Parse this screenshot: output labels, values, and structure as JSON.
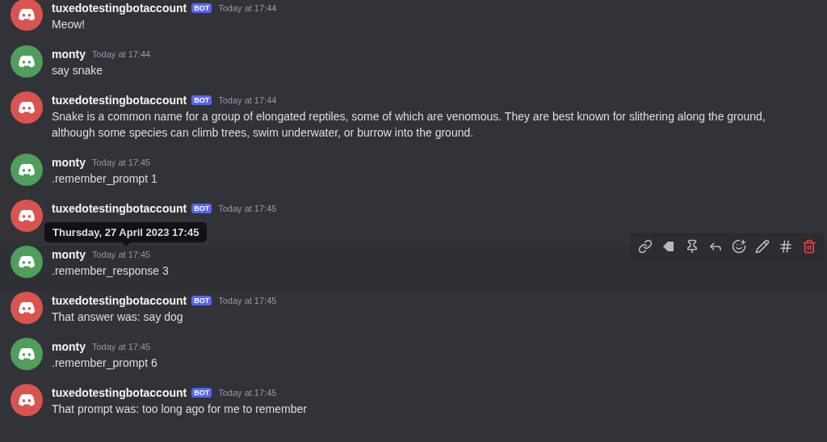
{
  "messages": [
    {
      "author": "tuxedotestingbotaccount",
      "bot": true,
      "badge": "BOT",
      "color": "#d9534f",
      "time": "Today at 17:44",
      "lines": [
        "Meow!"
      ],
      "hovered": false
    },
    {
      "author": "monty",
      "bot": false,
      "color": "#4f9e5c",
      "time": "Today at 17:44",
      "lines": [
        "say snake"
      ],
      "hovered": false
    },
    {
      "author": "tuxedotestingbotaccount",
      "bot": true,
      "badge": "BOT",
      "color": "#d9534f",
      "time": "Today at 17:44",
      "lines": [
        "Snake is a common name for a group of elongated reptiles, some of which are venomous. They are best known for slithering along the ground,",
        "although some species can climb trees, swim underwater, or burrow into the ground."
      ],
      "hovered": false
    },
    {
      "author": "monty",
      "bot": false,
      "color": "#4f9e5c",
      "time": "Today at 17:45",
      "lines": [
        ".remember_prompt 1"
      ],
      "hovered": false
    },
    {
      "author": "tuxedotestingbotaccount",
      "bot": true,
      "badge": "BOT",
      "color": "#d9534f",
      "time": "Today at 17:45",
      "hovered": false
    },
    {
      "author": "monty",
      "bot": false,
      "color": "#4f9e5c",
      "time": "Today at 17:45",
      "lines": [
        ".remember_response 3"
      ],
      "hovered": true,
      "tooltip": "Thursday, 27 April 2023 17:45"
    },
    {
      "author": "tuxedotestingbotaccount",
      "bot": true,
      "badge": "BOT",
      "color": "#d9534f",
      "time": "Today at 17:45",
      "lines": [
        "That answer was:  say dog"
      ],
      "hovered": false
    },
    {
      "author": "monty",
      "bot": false,
      "color": "#4f9e5c",
      "time": "Today at 17:45",
      "lines": [
        ".remember_prompt 6"
      ],
      "hovered": false
    },
    {
      "author": "tuxedotestingbotaccount",
      "bot": true,
      "badge": "BOT",
      "color": "#d9534f",
      "time": "Today at 17:45",
      "lines": [
        "That prompt was:  too long ago for me to remember"
      ],
      "hovered": false
    }
  ],
  "toolbar": [
    {
      "kind": "link"
    },
    {
      "kind": "label"
    },
    {
      "kind": "pin"
    },
    {
      "kind": "reply"
    },
    {
      "kind": "reaction"
    },
    {
      "kind": "edit"
    },
    {
      "kind": "thread"
    },
    {
      "kind": "delete"
    }
  ]
}
